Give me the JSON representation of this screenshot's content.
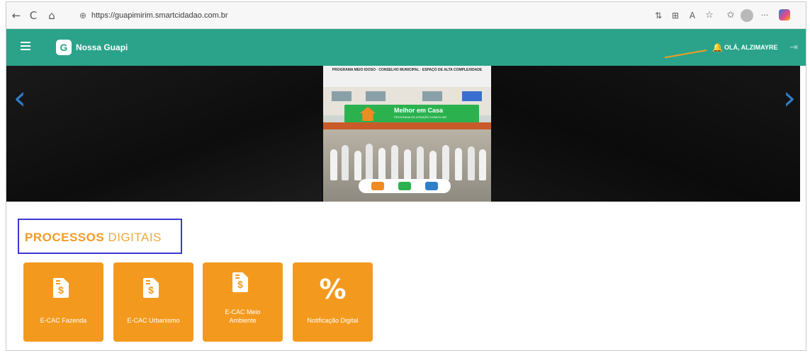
{
  "browser": {
    "back_icon": "←",
    "refresh_icon": "C",
    "home_icon": "⌂",
    "lock_icon": "⊕",
    "url": "https://guapimirim.smartcidadao.com.br",
    "toolbar_icons": [
      "⇅",
      "⊞",
      "A",
      "☆",
      "✩"
    ],
    "more_icon": "···"
  },
  "header": {
    "brand": "Nossa Guapi",
    "bell_icon": "🔔",
    "greeting": "OLÁ, ALZIMAYRE",
    "logout_icon": "⇥",
    "bg_color": "#2aa38a"
  },
  "carousel": {
    "prev_icon": "‹",
    "next_icon": "›",
    "banner_top_text": "PROGRAMA MEIO IDOSO · CONSELHO MUNICIPAL · ESPAÇO DE ALTA COMPLEXIDADE",
    "banner_sign_title": "Melhor em Casa",
    "banner_sign_sub": "PROGRAMA DE ATENÇÃO DOMICILIAR"
  },
  "section": {
    "title_strong": "PROCESSOS",
    "title_light": "DIGITAIS",
    "accent_color": "#f39a1e"
  },
  "cards": [
    {
      "label": "E-CAC Fazenda",
      "icon": "invoice-icon"
    },
    {
      "label": "E-CAC Urbanismo",
      "icon": "invoice-icon"
    },
    {
      "label": "E-CAC Meio Ambiente",
      "icon": "invoice-icon"
    },
    {
      "label": "Notificação Digital",
      "icon": "percent-icon"
    }
  ]
}
